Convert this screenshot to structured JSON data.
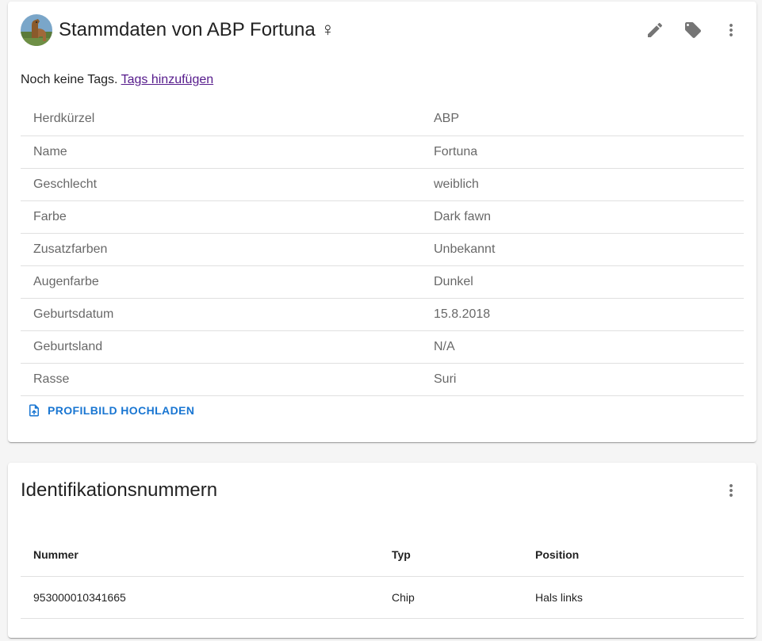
{
  "master": {
    "title": "Stammdaten von ABP Fortuna ♀",
    "actions": [
      {
        "name": "edit-icon",
        "label": "Bearbeiten"
      },
      {
        "name": "tag-icon",
        "label": "Tags"
      },
      {
        "name": "more-vert-icon",
        "label": "Mehr"
      }
    ],
    "tags_text": "Noch keine Tags.",
    "tags_link": "Tags hinzufügen",
    "rows": [
      {
        "key": "Herdkürzel",
        "value": "ABP"
      },
      {
        "key": "Name",
        "value": "Fortuna"
      },
      {
        "key": "Geschlecht",
        "value": "weiblich"
      },
      {
        "key": "Farbe",
        "value": "Dark fawn"
      },
      {
        "key": "Zusatzfarben",
        "value": "Unbekannt"
      },
      {
        "key": "Augenfarbe",
        "value": "Dunkel"
      },
      {
        "key": "Geburtsdatum",
        "value": "15.8.2018"
      },
      {
        "key": "Geburtsland",
        "value": "N/A"
      },
      {
        "key": "Rasse",
        "value": "Suri"
      }
    ],
    "upload_label": "PROFILBILD HOCHLADEN"
  },
  "ids": {
    "title": "Identifikationsnummern",
    "columns": [
      "Nummer",
      "Typ",
      "Position"
    ],
    "rows": [
      [
        "953000010341665",
        "Chip",
        "Hals links"
      ]
    ]
  },
  "colors": {
    "accent": "#1976d2",
    "link_visited": "#551a8b",
    "divider": "#e0e0e0"
  }
}
